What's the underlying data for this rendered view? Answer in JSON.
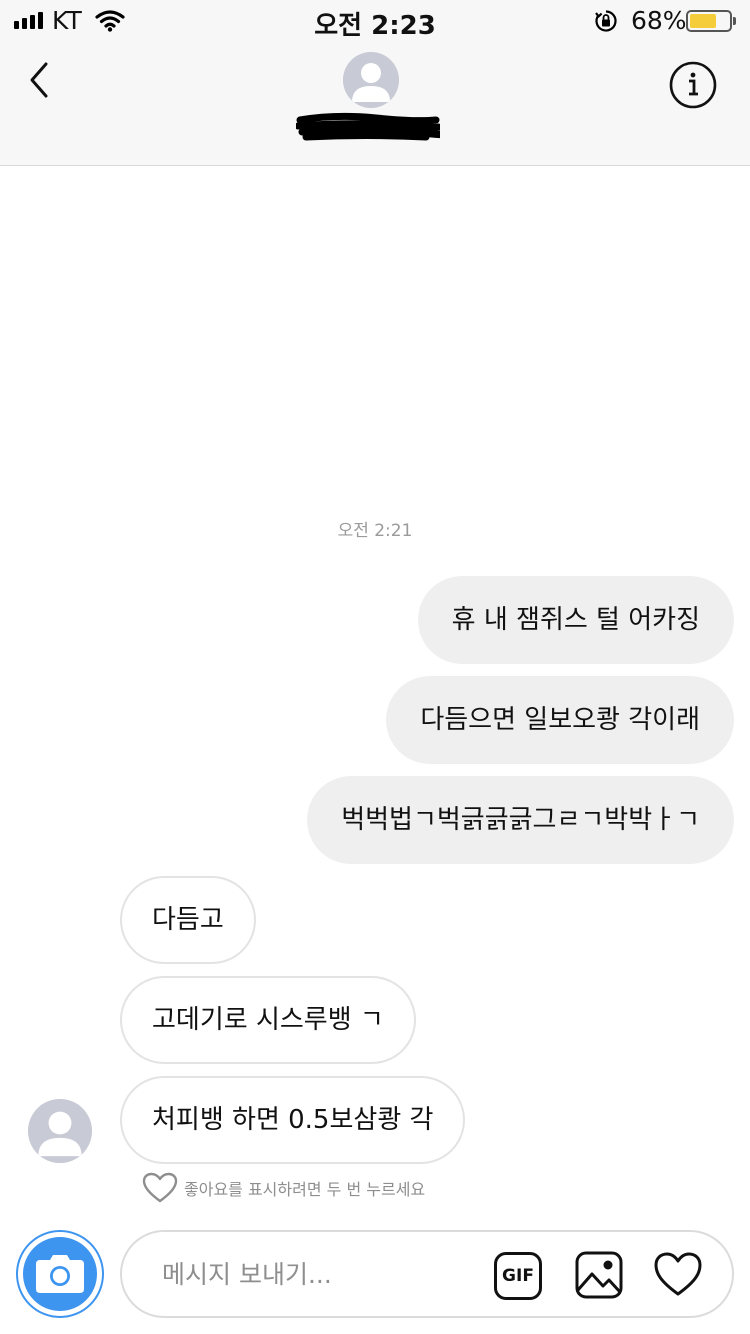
{
  "status_bar": {
    "carrier": "KT",
    "time": "오전 2:23",
    "battery_percent": "68%",
    "battery_level": 0.68,
    "battery_color": "#f5cd3a"
  },
  "header": {
    "back_icon": "chevron-left-icon",
    "avatar_icon": "default-avatar-icon",
    "info_icon": "info-icon"
  },
  "conversation": {
    "timestamp": "오전 2:21",
    "sent": [
      {
        "text": "휴 내 잼쥐스 털 어카징"
      },
      {
        "text": "다듬으면 일보오쾅 각이래"
      },
      {
        "text": "벅벅법ㄱ벅긁긁긁그ㄹㄱ박박ㅏㄱ"
      }
    ],
    "received": [
      {
        "text": "다듬고"
      },
      {
        "text": "고데기로 시스루뱅 ㄱ"
      },
      {
        "text": "처피뱅 하면 0.5보삼쾅 각"
      }
    ],
    "like_hint": "좋아요를 표시하려면 두 번 누르세요"
  },
  "composer": {
    "placeholder": "메시지 보내기...",
    "value": "",
    "gif_label": "GIF",
    "camera_icon": "camera-icon",
    "gallery_icon": "gallery-icon",
    "heart_icon": "heart-icon",
    "accent_color": "#3d95f0"
  }
}
